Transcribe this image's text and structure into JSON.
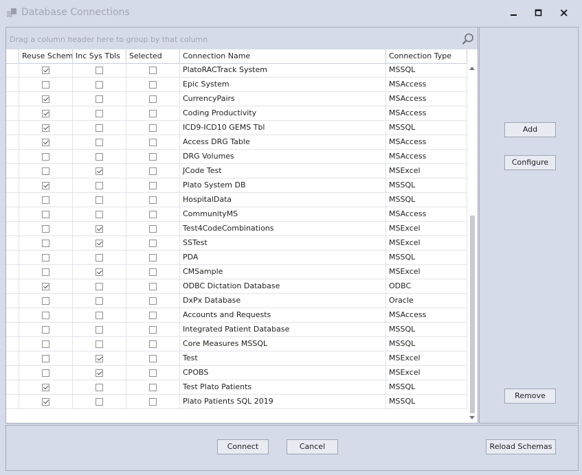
{
  "window": {
    "title": "Database Connections"
  },
  "grid": {
    "group_hint": "Drag a column header here to group by that column",
    "columns": [
      "Reuse Schema",
      "Inc Sys Tbls",
      "Selected",
      "Connection Name",
      "Connection Type"
    ],
    "rows": [
      {
        "reuse": true,
        "inc": false,
        "selected": false,
        "name": "PlatoRACTrack System",
        "type": "MSSQL"
      },
      {
        "reuse": false,
        "inc": false,
        "selected": false,
        "name": "Epic System",
        "type": "MSAccess"
      },
      {
        "reuse": true,
        "inc": false,
        "selected": false,
        "name": "CurrencyPairs",
        "type": "MSAccess"
      },
      {
        "reuse": true,
        "inc": false,
        "selected": false,
        "name": "Coding Productivity",
        "type": "MSAccess"
      },
      {
        "reuse": true,
        "inc": false,
        "selected": false,
        "name": "ICD9-ICD10 GEMS Tbl",
        "type": "MSSQL"
      },
      {
        "reuse": true,
        "inc": false,
        "selected": false,
        "name": "Access DRG Table",
        "type": "MSAccess"
      },
      {
        "reuse": false,
        "inc": false,
        "selected": false,
        "name": "DRG Volumes",
        "type": "MSAccess"
      },
      {
        "reuse": false,
        "inc": true,
        "selected": false,
        "name": "JCode Test",
        "type": "MSExcel"
      },
      {
        "reuse": true,
        "inc": false,
        "selected": false,
        "name": "Plato System DB",
        "type": "MSSQL"
      },
      {
        "reuse": false,
        "inc": false,
        "selected": false,
        "name": "HospitalData",
        "type": "MSSQL"
      },
      {
        "reuse": false,
        "inc": false,
        "selected": false,
        "name": "CommunityMS",
        "type": "MSAccess"
      },
      {
        "reuse": false,
        "inc": true,
        "selected": false,
        "name": "Test4CodeCombinations",
        "type": "MSExcel"
      },
      {
        "reuse": false,
        "inc": true,
        "selected": false,
        "name": "SSTest",
        "type": "MSExcel"
      },
      {
        "reuse": false,
        "inc": false,
        "selected": false,
        "name": "PDA",
        "type": "MSSQL"
      },
      {
        "reuse": false,
        "inc": true,
        "selected": false,
        "name": "CMSample",
        "type": "MSExcel"
      },
      {
        "reuse": true,
        "inc": false,
        "selected": false,
        "name": "ODBC Dictation Database",
        "type": "ODBC"
      },
      {
        "reuse": false,
        "inc": false,
        "selected": false,
        "name": "DxPx Database",
        "type": "Oracle"
      },
      {
        "reuse": false,
        "inc": false,
        "selected": false,
        "name": "Accounts and Requests",
        "type": "MSAccess"
      },
      {
        "reuse": false,
        "inc": false,
        "selected": false,
        "name": "Integrated Patient Database",
        "type": "MSSQL"
      },
      {
        "reuse": false,
        "inc": false,
        "selected": false,
        "name": "Core Measures MSSQL",
        "type": "MSSQL"
      },
      {
        "reuse": false,
        "inc": true,
        "selected": false,
        "name": "Test",
        "type": "MSExcel"
      },
      {
        "reuse": false,
        "inc": true,
        "selected": false,
        "name": "CPOBS",
        "type": "MSExcel"
      },
      {
        "reuse": true,
        "inc": false,
        "selected": false,
        "name": "Test Plato Patients",
        "type": "MSSQL"
      },
      {
        "reuse": true,
        "inc": false,
        "selected": false,
        "name": "Plato Patients SQL 2019",
        "type": "MSSQL"
      }
    ]
  },
  "side_buttons": {
    "add": "Add",
    "configure": "Configure",
    "remove": "Remove"
  },
  "bottom_buttons": {
    "connect": "Connect",
    "cancel": "Cancel",
    "reload": "Reload Schemas"
  }
}
